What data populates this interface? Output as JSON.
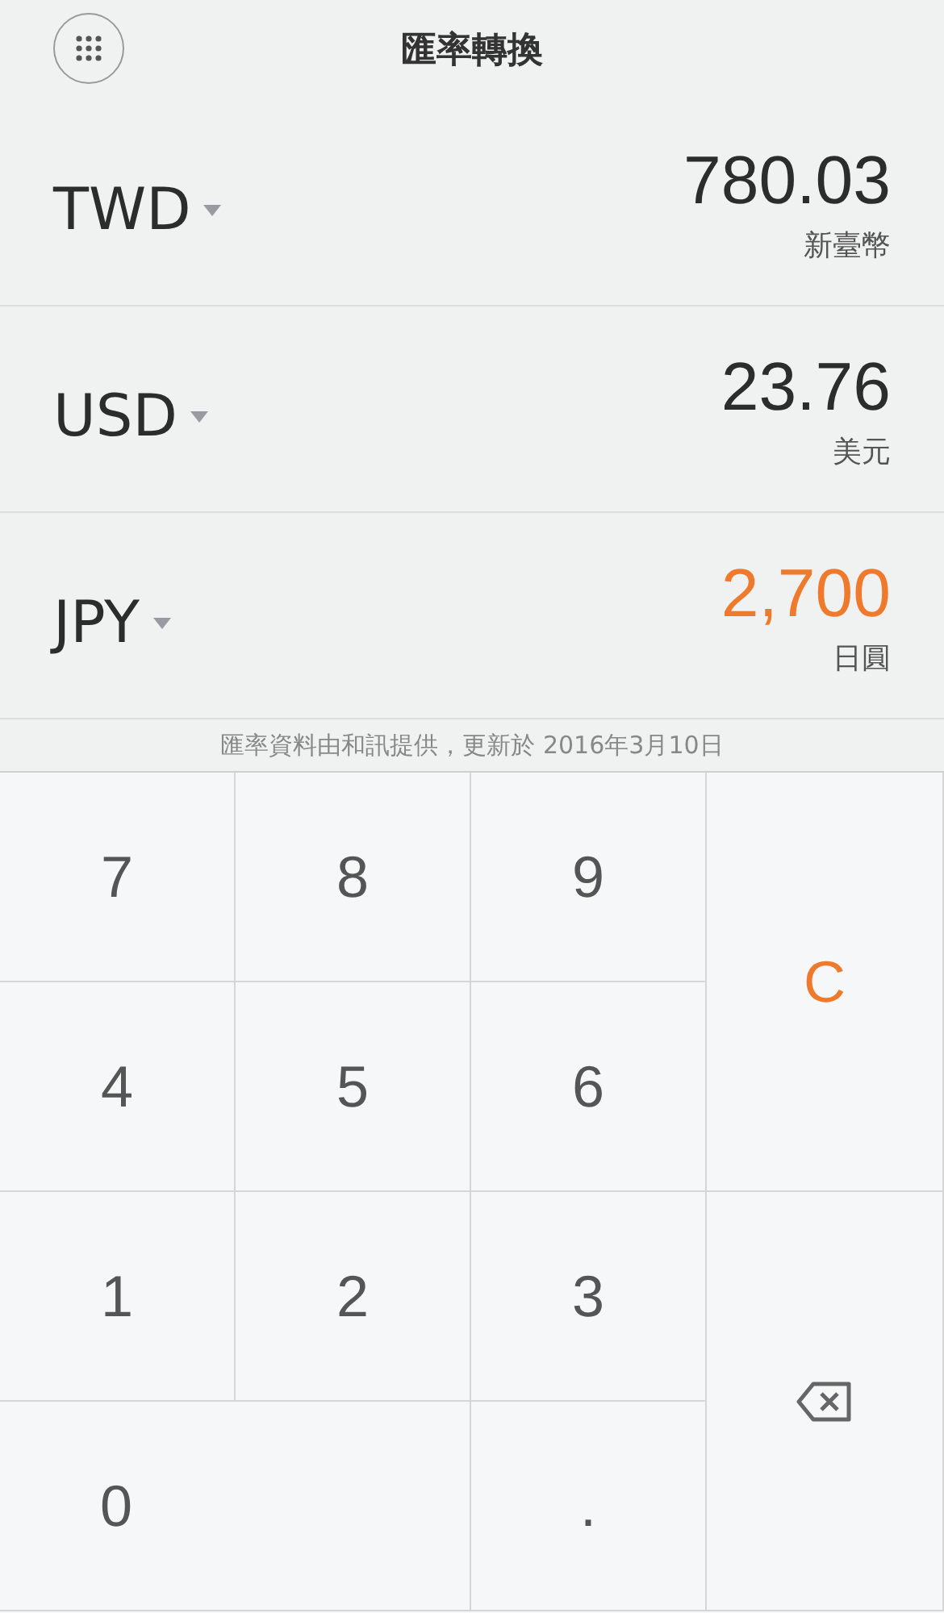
{
  "header": {
    "title": "匯率轉換"
  },
  "currencies": [
    {
      "code": "TWD",
      "value": "780.03",
      "name": "新臺幣",
      "selected": false
    },
    {
      "code": "USD",
      "value": "23.76",
      "name": "美元",
      "selected": false
    },
    {
      "code": "JPY",
      "value": "2,700",
      "name": "日圓",
      "selected": true
    }
  ],
  "source_note": "匯率資料由和訊提供，更新於 2016年3月10日",
  "keys": [
    {
      "kind": "digit",
      "label": "7"
    },
    {
      "kind": "digit",
      "label": "8"
    },
    {
      "kind": "digit",
      "label": "9"
    },
    {
      "kind": "clear",
      "label": "C"
    },
    {
      "kind": "digit",
      "label": "4"
    },
    {
      "kind": "digit",
      "label": "5"
    },
    {
      "kind": "digit",
      "label": "6"
    },
    {
      "kind": "digit",
      "label": "1"
    },
    {
      "kind": "digit",
      "label": "2"
    },
    {
      "kind": "digit",
      "label": "3"
    },
    {
      "kind": "backspace"
    },
    {
      "kind": "wide",
      "label": "0"
    },
    {
      "kind": "digit",
      "label": "."
    }
  ]
}
